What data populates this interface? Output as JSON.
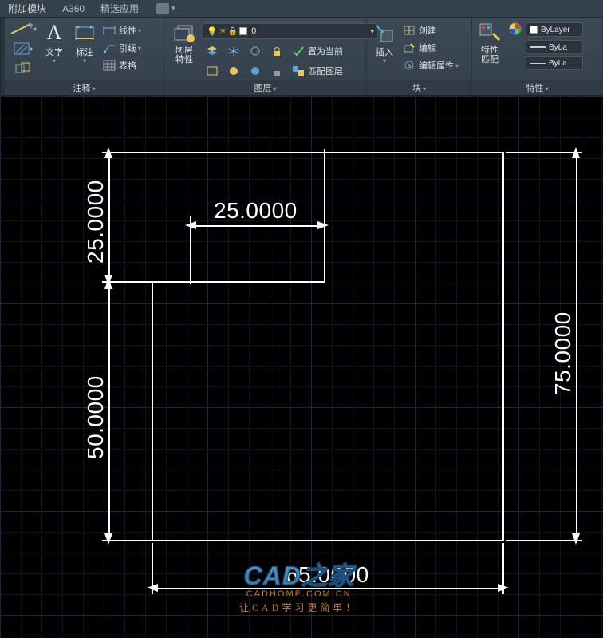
{
  "tabs": {
    "addon": "附加模块",
    "a360": "A360",
    "featured": "精选应用"
  },
  "ribbon": {
    "annot": {
      "title": "注释",
      "text": "文字",
      "dim": "标注",
      "linear": "线性",
      "leader": "引线",
      "table": "表格"
    },
    "layer": {
      "title": "图层",
      "props": "图层\n特性",
      "current": "0",
      "setcur": "置为当前",
      "match": "匹配图层"
    },
    "block": {
      "title": "块",
      "insert": "插入",
      "create": "创建",
      "edit": "编辑",
      "editattr": "编辑属性"
    },
    "props": {
      "title": "特性",
      "match": "特性\n匹配",
      "bylayer": "ByLayer",
      "bylayer2": "ByLa",
      "bylayer3": "ByLa"
    }
  },
  "dims": {
    "d25v": "25.0000",
    "d25h": "25.0000",
    "d50v": "50.0000",
    "d75v": "75.0000",
    "d65h": "65.0000"
  },
  "watermark": {
    "brand": "CAD之家",
    "url": "CADHOME.COM.CN",
    "slogan": "让CAD学习更简单！"
  }
}
